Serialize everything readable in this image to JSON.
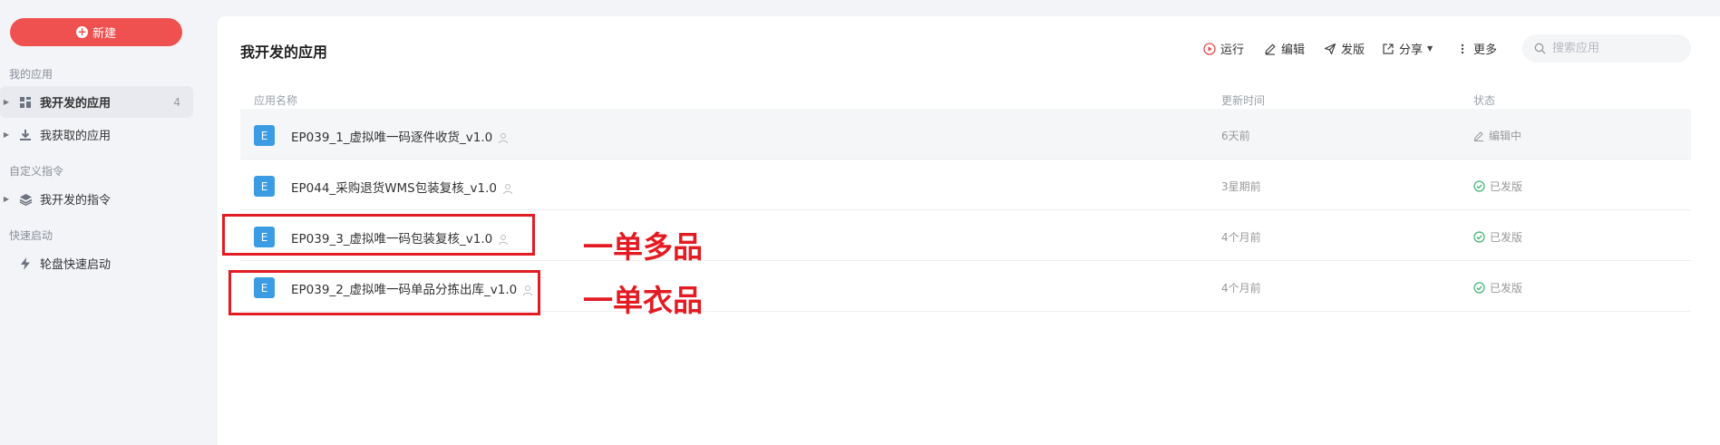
{
  "sidebar": {
    "new_label": "新建",
    "section_my_apps": "我的应用",
    "section_custom_cmd": "自定义指令",
    "section_quick_start": "快速启动",
    "items": [
      {
        "label": "我开发的应用",
        "count": "4",
        "icon": "grid-icon",
        "active": true
      },
      {
        "label": "我获取的应用",
        "icon": "download-icon"
      },
      {
        "label": "我开发的指令",
        "icon": "layers-icon"
      },
      {
        "label": "轮盘快速启动",
        "icon": "lightning-icon"
      }
    ]
  },
  "main": {
    "title": "我开发的应用",
    "toolbar": {
      "run": "运行",
      "edit": "编辑",
      "publish": "发版",
      "share": "分享",
      "more": "更多"
    },
    "search": {
      "placeholder": "搜索应用"
    },
    "columns": {
      "name": "应用名称",
      "updated": "更新时间",
      "status": "状态"
    },
    "rows": [
      {
        "badge": "E",
        "name": "EP039_1_虚拟唯一码逐件收货_v1.0",
        "time": "6天前",
        "status": "编辑中",
        "status_icon": "pencil-icon"
      },
      {
        "badge": "E",
        "name": "EP044_采购退货WMS包装复核_v1.0",
        "time": "3星期前",
        "status": "已发版",
        "status_icon": "check-circle-icon"
      },
      {
        "badge": "E",
        "name": "EP039_3_虚拟唯一码包装复核_v1.0",
        "time": "4个月前",
        "status": "已发版",
        "status_icon": "check-circle-icon"
      },
      {
        "badge": "E",
        "name": "EP039_2_虚拟唯一码单品分拣出库_v1.0",
        "time": "4个月前",
        "status": "已发版",
        "status_icon": "check-circle-icon"
      }
    ]
  },
  "annotations": [
    "一单多品",
    "一单衣品"
  ],
  "colors": {
    "accent": "#ef5050",
    "badge": "#3b9be3",
    "published": "#3cb371",
    "annotation": "#e31b23"
  }
}
